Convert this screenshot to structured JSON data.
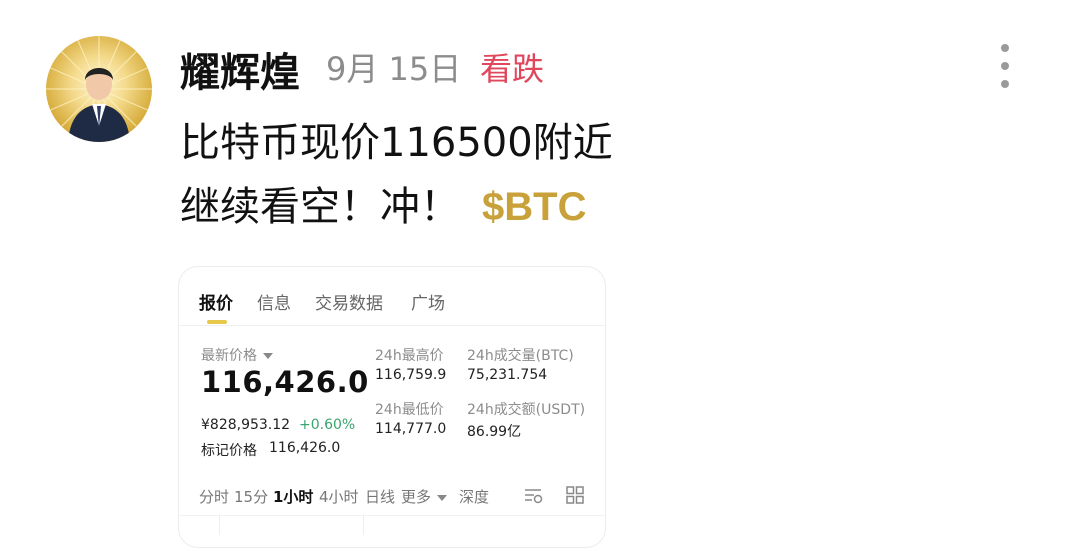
{
  "post": {
    "author": "耀辉煌",
    "date": "9月 15日",
    "sentiment": "看跌",
    "line1": "比特币现价116500附近",
    "line2": "继续看空！冲！",
    "ticker": "$BTC"
  },
  "card": {
    "tabs": [
      "报价",
      "信息",
      "交易数据",
      "广场"
    ],
    "latest_price_label": "最新价格",
    "latest_price": "116,426.0",
    "cny_price": "¥828,953.12",
    "change_pct": "+0.60%",
    "mark_price_label": "标记价格",
    "mark_price": "116,426.0",
    "high_label": "24h最高价",
    "high": "116,759.9",
    "low_label": "24h最低价",
    "low": "114,777.0",
    "vol_btc_label": "24h成交量(BTC)",
    "vol_btc": "75,231.754",
    "vol_usdt_label": "24h成交额(USDT)",
    "vol_usdt": "86.99亿",
    "intervals": [
      "分时",
      "15分",
      "1小时",
      "4小时",
      "日线",
      "更多",
      "深度"
    ]
  },
  "colors": {
    "sentiment": "#e0465c",
    "ticker": "#c9a13a",
    "positive": "#3aa56e",
    "tab_accent": "#e8c84a"
  },
  "icons": [
    "more-vertical-icon",
    "chevron-down-icon",
    "chart-settings-icon",
    "grid-layout-icon"
  ]
}
